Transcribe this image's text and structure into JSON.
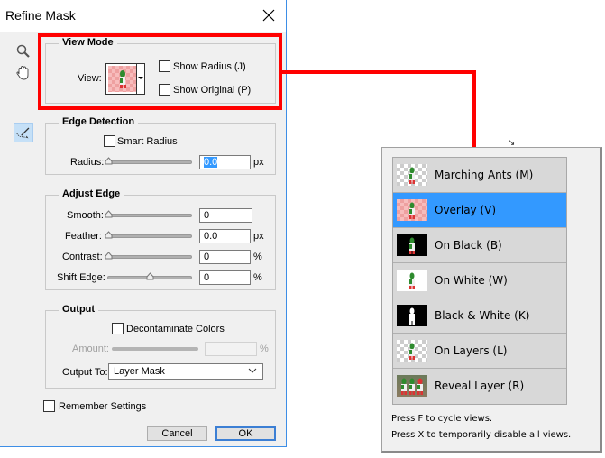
{
  "dialog": {
    "title": "Refine Mask",
    "tools": [
      "zoom-tool",
      "hand-tool",
      "refine-radius-tool"
    ],
    "view_mode": {
      "title": "View Mode",
      "view_label": "View:",
      "view_selected": "Overlay (V)",
      "show_radius": {
        "label": "Show Radius (J)",
        "checked": false
      },
      "show_original": {
        "label": "Show Original (P)",
        "checked": false
      }
    },
    "edge_detection": {
      "title": "Edge Detection",
      "smart_radius": {
        "label": "Smart Radius",
        "checked": false
      },
      "radius": {
        "label": "Radius:",
        "value": "0.0",
        "unit": "px",
        "slider_fraction": 0.0
      }
    },
    "adjust_edge": {
      "title": "Adjust Edge",
      "smooth": {
        "label": "Smooth:",
        "value": "0",
        "unit": "",
        "slider_fraction": 0.0
      },
      "feather": {
        "label": "Feather:",
        "value": "0.0",
        "unit": "px",
        "slider_fraction": 0.0
      },
      "contrast": {
        "label": "Contrast:",
        "value": "0",
        "unit": "%",
        "slider_fraction": 0.0
      },
      "shift_edge": {
        "label": "Shift Edge:",
        "value": "0",
        "unit": "%",
        "slider_fraction": 0.5
      }
    },
    "output": {
      "title": "Output",
      "decontaminate": {
        "label": "Decontaminate Colors",
        "checked": false
      },
      "amount": {
        "label": "Amount:",
        "value": "",
        "unit": "%",
        "disabled": true
      },
      "output_to": {
        "label": "Output To:",
        "value": "Layer Mask"
      }
    },
    "remember_settings": {
      "label": "Remember Settings",
      "checked": false
    },
    "buttons": {
      "cancel": "Cancel",
      "ok": "OK"
    }
  },
  "view_popup": {
    "items": [
      {
        "label": "Marching Ants (M)",
        "thumb": "checker-gray",
        "selected": false
      },
      {
        "label": "Overlay (V)",
        "thumb": "checker-pink",
        "selected": true
      },
      {
        "label": "On Black (B)",
        "thumb": "black",
        "selected": false
      },
      {
        "label": "On White (W)",
        "thumb": "white",
        "selected": false
      },
      {
        "label": "Black & White (K)",
        "thumb": "black-white",
        "selected": false
      },
      {
        "label": "On Layers (L)",
        "thumb": "checker-gray",
        "selected": false
      },
      {
        "label": "Reveal Layer (R)",
        "thumb": "photo",
        "selected": false
      }
    ],
    "hints": [
      "Press F to cycle views.",
      "Press X to temporarily disable all views."
    ]
  },
  "annotation": {
    "color": "#ff0000"
  },
  "colors": {
    "selected": "#3399ff",
    "dialog_bg": "#f0f0f0",
    "ok_border": "#3c7fd4"
  }
}
